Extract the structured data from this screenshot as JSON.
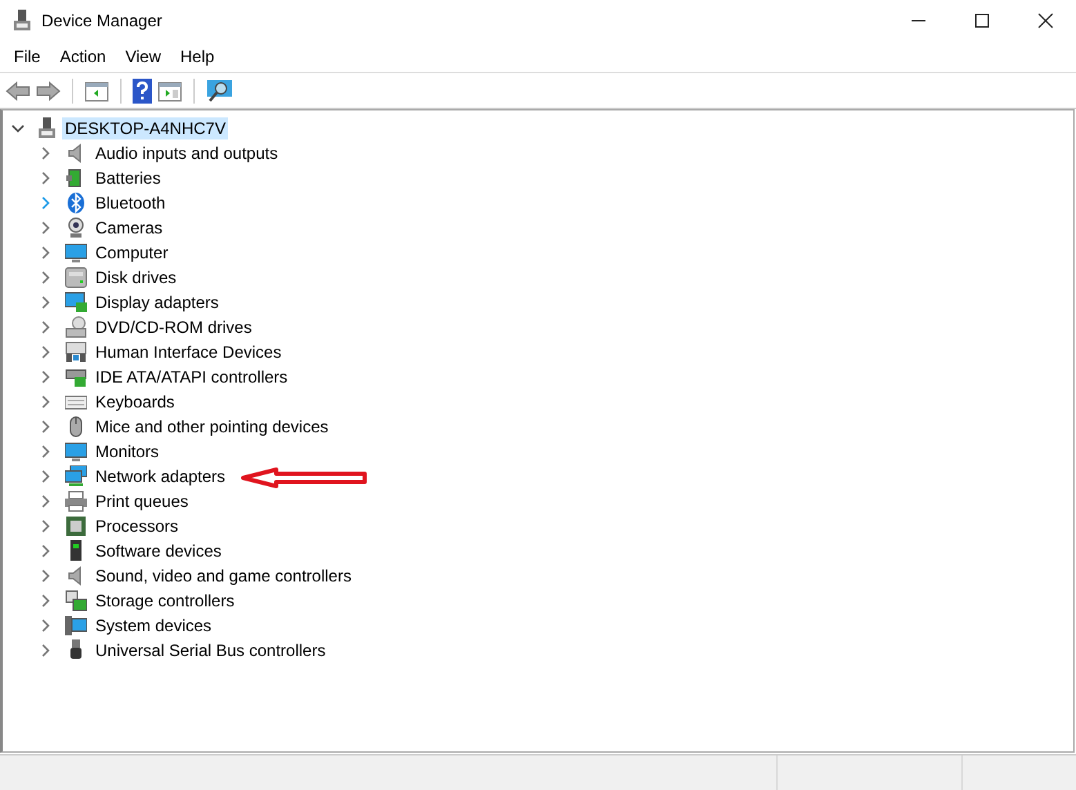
{
  "window": {
    "title": "Device Manager"
  },
  "menu": [
    "File",
    "Action",
    "View",
    "Help"
  ],
  "tree": {
    "label": "DESKTOP-A4NHC7V",
    "expanded": true,
    "selected": true,
    "children": [
      {
        "label": "Audio inputs and outputs",
        "kind": "speaker",
        "selected": false,
        "hovered": false
      },
      {
        "label": "Batteries",
        "kind": "battery",
        "selected": false,
        "hovered": false
      },
      {
        "label": "Bluetooth",
        "kind": "bluetooth",
        "selected": false,
        "hovered": true
      },
      {
        "label": "Cameras",
        "kind": "camera",
        "selected": false,
        "hovered": false
      },
      {
        "label": "Computer",
        "kind": "monitor",
        "selected": false,
        "hovered": false
      },
      {
        "label": "Disk drives",
        "kind": "disk",
        "selected": false,
        "hovered": false
      },
      {
        "label": "Display adapters",
        "kind": "display",
        "selected": false,
        "hovered": false
      },
      {
        "label": "DVD/CD-ROM drives",
        "kind": "dvd",
        "selected": false,
        "hovered": false
      },
      {
        "label": "Human Interface Devices",
        "kind": "hid",
        "selected": false,
        "hovered": false
      },
      {
        "label": "IDE ATA/ATAPI controllers",
        "kind": "card",
        "selected": false,
        "hovered": false
      },
      {
        "label": "Keyboards",
        "kind": "keyboard",
        "selected": false,
        "hovered": false
      },
      {
        "label": "Mice and other pointing devices",
        "kind": "mouse",
        "selected": false,
        "hovered": false
      },
      {
        "label": "Monitors",
        "kind": "monitor",
        "selected": false,
        "hovered": false
      },
      {
        "label": "Network adapters",
        "kind": "network",
        "selected": false,
        "hovered": false
      },
      {
        "label": "Print queues",
        "kind": "printer",
        "selected": false,
        "hovered": false
      },
      {
        "label": "Processors",
        "kind": "chip",
        "selected": false,
        "hovered": false
      },
      {
        "label": "Software devices",
        "kind": "tower",
        "selected": false,
        "hovered": false
      },
      {
        "label": "Sound, video and game controllers",
        "kind": "speaker",
        "selected": false,
        "hovered": false
      },
      {
        "label": "Storage controllers",
        "kind": "storage",
        "selected": false,
        "hovered": false
      },
      {
        "label": "System devices",
        "kind": "system",
        "selected": false,
        "hovered": false
      },
      {
        "label": "Universal Serial Bus controllers",
        "kind": "usb",
        "selected": false,
        "hovered": false
      }
    ]
  }
}
